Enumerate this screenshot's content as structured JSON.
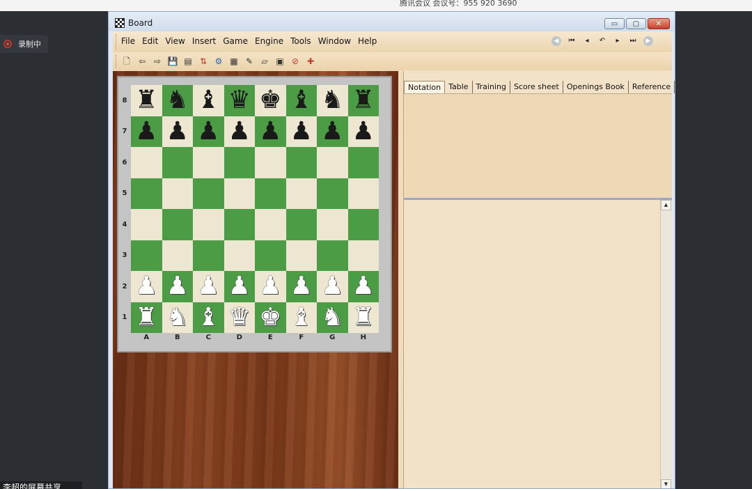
{
  "meeting": {
    "header_text": "腾讯会议 会议号：955 920 3690",
    "recording_label": "录制中",
    "share_label": "李超的屏幕共享"
  },
  "window": {
    "title": "Board",
    "minimize_symbol": "▭",
    "maximize_symbol": "▢",
    "close_symbol": "✕"
  },
  "menu": {
    "items": [
      "File",
      "Edit",
      "View",
      "Insert",
      "Game",
      "Engine",
      "Tools",
      "Window",
      "Help"
    ]
  },
  "nav": {
    "buttons": [
      {
        "name": "back-round-icon",
        "glyph": "◀"
      },
      {
        "name": "first-move-icon",
        "glyph": "⏮"
      },
      {
        "name": "prev-move-icon",
        "glyph": "◂"
      },
      {
        "name": "undo-icon",
        "glyph": "↶"
      },
      {
        "name": "next-move-icon",
        "glyph": "▸"
      },
      {
        "name": "last-move-icon",
        "glyph": "⏭"
      },
      {
        "name": "forward-round-icon",
        "glyph": "▶"
      }
    ]
  },
  "toolbar": {
    "icons": [
      {
        "name": "new-document-icon",
        "glyph": "🗋"
      },
      {
        "name": "back-arrow-icon",
        "glyph": "⇦"
      },
      {
        "name": "forward-arrow-icon",
        "glyph": "⇨"
      },
      {
        "name": "save-icon",
        "glyph": "💾"
      },
      {
        "name": "database-icon",
        "glyph": "▤"
      },
      {
        "name": "sort-icon",
        "glyph": "⇅"
      },
      {
        "name": "analysis-icon",
        "glyph": "⚙"
      },
      {
        "name": "properties-icon",
        "glyph": "▦"
      },
      {
        "name": "pencil-icon",
        "glyph": "✎"
      },
      {
        "name": "eraser-icon",
        "glyph": "▱"
      },
      {
        "name": "camera-icon",
        "glyph": "▣"
      },
      {
        "name": "clear-board-icon",
        "glyph": "⊘"
      },
      {
        "name": "flip-board-icon",
        "glyph": "✚"
      }
    ]
  },
  "board": {
    "files": [
      "A",
      "B",
      "C",
      "D",
      "E",
      "F",
      "G",
      "H"
    ],
    "ranks": [
      "8",
      "7",
      "6",
      "5",
      "4",
      "3",
      "2",
      "1"
    ],
    "light_color": "#ede6d0",
    "dark_color": "#4c9c46",
    "position": [
      [
        "r",
        "n",
        "b",
        "q",
        "k",
        "b",
        "n",
        "r"
      ],
      [
        "p",
        "p",
        "p",
        "p",
        "p",
        "p",
        "p",
        "p"
      ],
      [
        "",
        "",
        "",
        "",
        "",
        "",
        "",
        ""
      ],
      [
        "",
        "",
        "",
        "",
        "",
        "",
        "",
        ""
      ],
      [
        "",
        "",
        "",
        "",
        "",
        "",
        "",
        ""
      ],
      [
        "",
        "",
        "",
        "",
        "",
        "",
        "",
        ""
      ],
      [
        "P",
        "P",
        "P",
        "P",
        "P",
        "P",
        "P",
        "P"
      ],
      [
        "R",
        "N",
        "B",
        "Q",
        "K",
        "B",
        "N",
        "R"
      ]
    ]
  },
  "tabs": [
    {
      "label": "Notation",
      "active": true
    },
    {
      "label": "Table",
      "active": false
    },
    {
      "label": "Training",
      "active": false
    },
    {
      "label": "Score sheet",
      "active": false
    },
    {
      "label": "Openings Book",
      "active": false
    },
    {
      "label": "Reference",
      "active": false
    }
  ],
  "scrollbar": {
    "up_arrow": "▲",
    "down_arrow": "▼"
  }
}
